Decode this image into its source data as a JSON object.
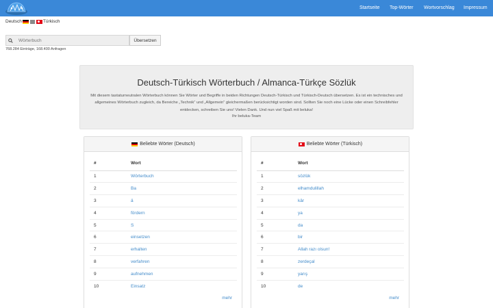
{
  "nav": {
    "logo_icon": "beluka-logo-icon",
    "links": [
      "Startseite",
      "Top-Wörter",
      "Wortvorschlag",
      "Impressum"
    ]
  },
  "lang": {
    "source": "Deutsch",
    "target": "Türkisch",
    "switch_icon": "swap-icon"
  },
  "search": {
    "icon": "search-icon",
    "placeholder": "Wörterbuch",
    "button": "Übersetzen",
    "stats": "768.284 Einträge, 168.400 Anfragen"
  },
  "jumbotron": {
    "title": "Deutsch-Türkisch Wörterbuch / Almanca-Türkçe Sözlük",
    "text": "Mit diesem tastaturneutralen Wörterbuch können Sie Wörter und Begriffe in beiden Richtungen Deutsch-Türkisch und Türkisch-Deutsch übersetzen. Es ist ein technisches und allgemeines Wörterbuch zugleich, da Bereiche „Technik“ und „Allgemein“ gleichermaßen berücksichtigt worden sind. Sollten Sie noch eine Lücke oder einen Schreibfehler entdecken, schreiben Sie uns! Vielen Dank. Und nun viel Spaß mit beluka!",
    "signature": "Ihr beluka-Team"
  },
  "panels": [
    {
      "title": "Beliebte Wörter (Deutsch)",
      "flag": "flag-germany-icon",
      "col_num": "#",
      "col_word": "Wort",
      "rows": [
        {
          "n": "1",
          "w": "Wörterbuch"
        },
        {
          "n": "2",
          "w": "Ba"
        },
        {
          "n": "3",
          "w": "ä"
        },
        {
          "n": "4",
          "w": "fördern"
        },
        {
          "n": "5",
          "w": "S"
        },
        {
          "n": "6",
          "w": "einsetzen"
        },
        {
          "n": "7",
          "w": "erhalten"
        },
        {
          "n": "8",
          "w": "verfahren"
        },
        {
          "n": "9",
          "w": "aufnehmen"
        },
        {
          "n": "10",
          "w": "Einsatz"
        }
      ],
      "more": "mehr"
    },
    {
      "title": "Beliebte Wörter (Türkisch)",
      "flag": "flag-turkey-icon",
      "col_num": "#",
      "col_word": "Wort",
      "rows": [
        {
          "n": "1",
          "w": "sözlük"
        },
        {
          "n": "2",
          "w": "elhamdulillah"
        },
        {
          "n": "3",
          "w": "kâr"
        },
        {
          "n": "4",
          "w": "ya"
        },
        {
          "n": "5",
          "w": "da"
        },
        {
          "n": "6",
          "w": "bir"
        },
        {
          "n": "7",
          "w": "Allah razı olsun!"
        },
        {
          "n": "8",
          "w": "zerdeçal"
        },
        {
          "n": "9",
          "w": "yarış"
        },
        {
          "n": "10",
          "w": "de"
        }
      ],
      "more": "mehr"
    }
  ],
  "colors": {
    "navbar": "#3a88d8",
    "link": "#428bca",
    "jumbotron": "#eeeeee"
  }
}
